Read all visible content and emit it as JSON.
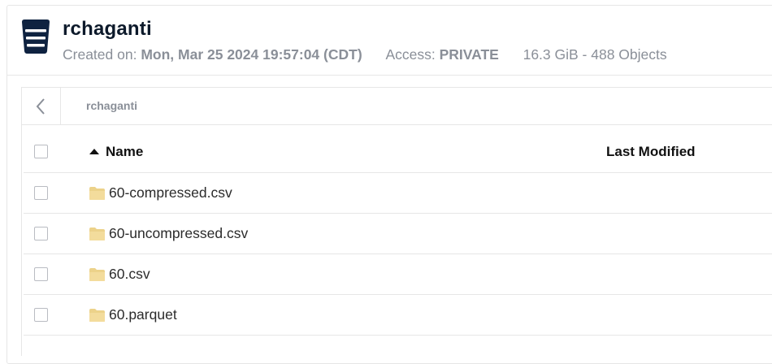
{
  "bucket": {
    "name": "rchaganti",
    "created_label": "Created on:",
    "created_value": "Mon, Mar 25 2024 19:57:04 (CDT)",
    "access_label": "Access:",
    "access_value": "PRIVATE",
    "usage": "16.3 GiB - 488 Objects"
  },
  "breadcrumb": {
    "path": "rchaganti"
  },
  "table": {
    "columns": {
      "name": "Name",
      "last_modified": "Last Modified"
    },
    "rows": [
      {
        "name": "60-compressed.csv",
        "type": "folder",
        "last_modified": ""
      },
      {
        "name": "60-uncompressed.csv",
        "type": "folder",
        "last_modified": ""
      },
      {
        "name": "60.csv",
        "type": "folder",
        "last_modified": ""
      },
      {
        "name": "60.parquet",
        "type": "folder",
        "last_modified": ""
      }
    ]
  },
  "icons": {
    "bucket": "bucket-icon",
    "back": "chevron-left-icon",
    "sort": "sort-ascending-icon",
    "folder": "folder-icon"
  },
  "colors": {
    "bucket_icon": "#0e2240",
    "folder": "#f0d58a",
    "muted_text": "#8a8f98"
  }
}
